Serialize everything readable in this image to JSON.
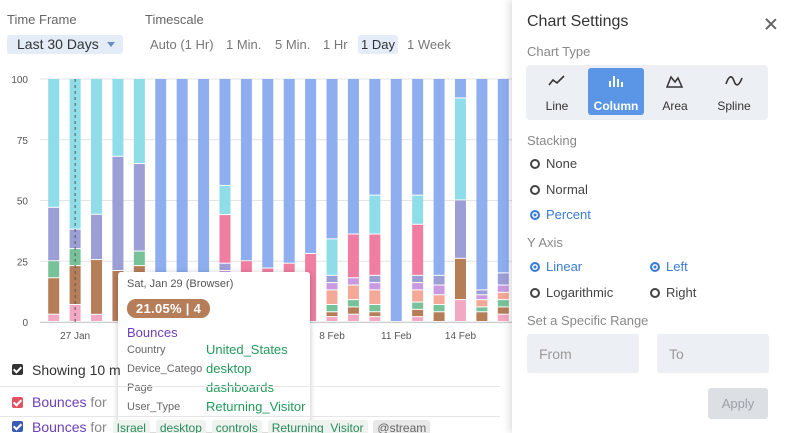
{
  "controls": {
    "time_frame_label": "Time Frame",
    "timescale_label": "Timescale",
    "time_frame_value": "Last 30 Days",
    "timescale_options": [
      "Auto (1 Hr)",
      "1 Min.",
      "5 Min.",
      "1 Hr",
      "1 Day",
      "1 Week"
    ],
    "timescale_active": "1 Day"
  },
  "chart_data": {
    "type": "bar",
    "stacking": "percent",
    "ylim": [
      0,
      100
    ],
    "yticks": [
      "0",
      "25",
      "50",
      "75",
      "100"
    ],
    "xtick_labels": [
      "27 Jan",
      "8 Feb",
      "11 Feb",
      "14 Feb"
    ],
    "categories": [
      "Jan 26",
      "Jan 27",
      "Jan 28",
      "Jan 29",
      "Jan 30",
      "Jan 31",
      "Feb 1",
      "Feb 2",
      "Feb 3",
      "Feb 4",
      "Feb 5",
      "Feb 6",
      "Feb 7",
      "Feb 8",
      "Feb 9",
      "Feb 10",
      "Feb 11",
      "Feb 12",
      "Feb 13",
      "Feb 14",
      "Feb 15",
      "Feb 16"
    ],
    "colors": [
      "#f2a8c2",
      "#b67d59",
      "#78c29a",
      "#f3a898",
      "#c99ae0",
      "#9b9fd6",
      "#f07ea2",
      "#8fdde8",
      "#8eaef0"
    ],
    "series": [
      {
        "values": [
          3,
          7,
          3,
          0,
          3,
          0,
          0,
          0,
          3,
          0,
          0,
          0,
          0,
          2,
          3,
          2,
          0,
          2,
          0,
          9,
          0,
          3
        ]
      },
      {
        "values": [
          15,
          16,
          23,
          21,
          20,
          0,
          0,
          0,
          3,
          0,
          0,
          0,
          0,
          2,
          3,
          2,
          0,
          3,
          4,
          17,
          4,
          3
        ]
      },
      {
        "values": [
          7,
          7,
          0,
          0,
          6,
          0,
          0,
          0,
          5,
          0,
          0,
          0,
          0,
          3,
          3,
          3,
          0,
          3,
          3,
          0,
          2,
          3
        ]
      },
      {
        "values": [
          0,
          0,
          0,
          0,
          0,
          14,
          0,
          0,
          5,
          0,
          0,
          0,
          0,
          6,
          6,
          6,
          0,
          5,
          4,
          0,
          3,
          3
        ]
      },
      {
        "values": [
          0,
          0,
          0,
          0,
          0,
          0,
          0,
          0,
          5,
          0,
          0,
          0,
          0,
          3,
          3,
          3,
          0,
          3,
          4,
          0,
          2,
          3
        ]
      },
      {
        "values": [
          22,
          8,
          19,
          47,
          36,
          0,
          0,
          0,
          3,
          0,
          0,
          0,
          0,
          3,
          0,
          3,
          0,
          3,
          4,
          24,
          2,
          5
        ]
      },
      {
        "values": [
          0,
          0,
          0,
          0,
          0,
          0,
          15,
          0,
          20,
          25,
          22,
          24,
          28,
          0,
          18,
          17,
          0,
          21,
          0,
          0,
          0,
          0
        ]
      },
      {
        "values": [
          53,
          62,
          57,
          32,
          35,
          0,
          0,
          0,
          12,
          0,
          0,
          0,
          0,
          15,
          0,
          16,
          0,
          12,
          0,
          42,
          0,
          0
        ]
      },
      {
        "values": [
          0,
          0,
          0,
          0,
          0,
          86,
          85,
          100,
          44,
          75,
          78,
          76,
          72,
          66,
          64,
          48,
          100,
          48,
          81,
          8,
          87,
          80
        ]
      }
    ]
  },
  "tooltip": {
    "header": "Sat, Jan 29 (Browser)",
    "badge": "21.05% | 4",
    "metric": "Bounces",
    "rows": [
      {
        "key": "Country",
        "value": "United_States"
      },
      {
        "key": "Device_Catego",
        "value": "desktop"
      },
      {
        "key": "Page",
        "value": "dashboards"
      },
      {
        "key": "User_Type",
        "value": "Returning_Visitor"
      }
    ]
  },
  "list": {
    "showing_label": "Showing 10 m",
    "rows": [
      {
        "metric": "Bounces",
        "for": "for"
      },
      {
        "metric": "Bounces",
        "for": "for",
        "chips": [
          "Israel",
          "desktop",
          "controls",
          "Returning_Visitor"
        ],
        "stream": "@stream"
      }
    ]
  },
  "settings": {
    "title": "Chart Settings",
    "chart_type_label": "Chart Type",
    "chart_types": [
      "Line",
      "Column",
      "Area",
      "Spline"
    ],
    "chart_type_active": "Column",
    "stacking_label": "Stacking",
    "stacking_options": [
      "None",
      "Normal",
      "Percent"
    ],
    "stacking_active": "Percent",
    "y_axis_label": "Y Axis",
    "scale_options": [
      "Linear",
      "Logarithmic"
    ],
    "scale_active": "Linear",
    "side_options": [
      "Left",
      "Right"
    ],
    "side_active": "Left",
    "range_label": "Set a Specific Range",
    "from_placeholder": "From",
    "to_placeholder": "To",
    "apply_label": "Apply",
    "accent": "#5b95e6"
  }
}
